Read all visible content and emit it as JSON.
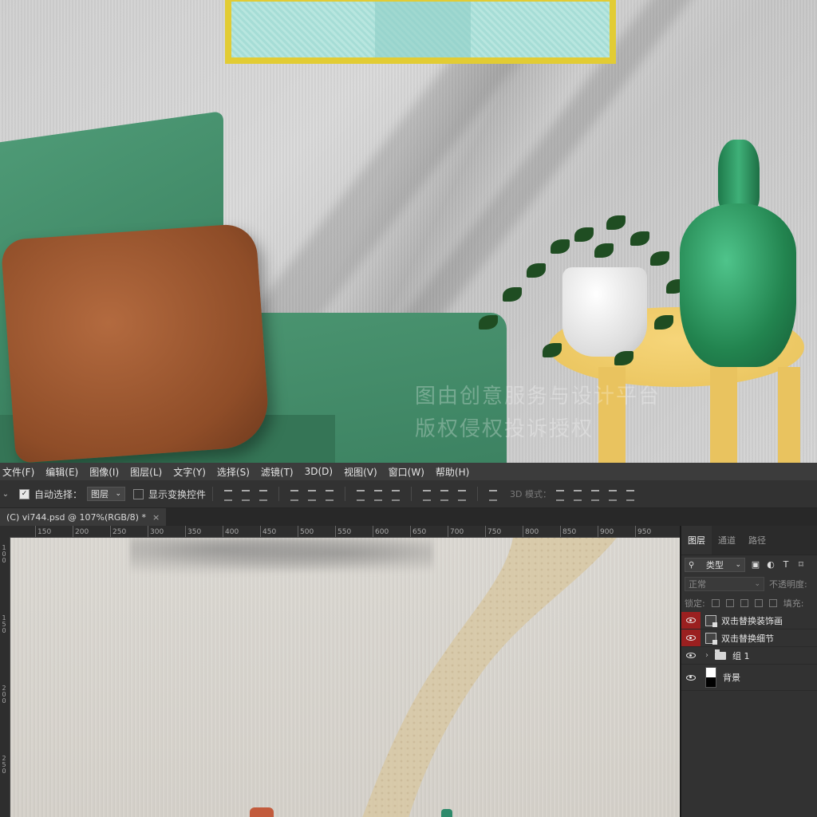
{
  "scene": {
    "watermark_line1": "图由创意服务与设计平台",
    "watermark_line2": "版权侵权投诉授权"
  },
  "menubar": {
    "items": [
      "文件(F)",
      "编辑(E)",
      "图像(I)",
      "图层(L)",
      "文字(Y)",
      "选择(S)",
      "滤镜(T)",
      "3D(D)",
      "视图(V)",
      "窗口(W)",
      "帮助(H)"
    ]
  },
  "options": {
    "auto_select_label": "自动选择：",
    "auto_select_value": "图层",
    "show_transform_label": "显示变换控件",
    "mode_3d_label": "3D 模式："
  },
  "tab": {
    "title": "(C) vi744.psd @ 107%(RGB/8) *",
    "close": "×"
  },
  "ruler": {
    "top_ticks": [
      "150",
      "200",
      "250",
      "300",
      "350",
      "400",
      "450",
      "500",
      "550",
      "600",
      "650",
      "700",
      "750",
      "800",
      "850",
      "900",
      "950"
    ],
    "left_ticks": [
      "100",
      "150",
      "200",
      "250"
    ]
  },
  "layers_panel": {
    "tabs": [
      "图层",
      "通道",
      "路径"
    ],
    "kind_label": "类型",
    "blend_mode": "正常",
    "opacity_label": "不透明度:",
    "lock_label": "锁定:",
    "fill_label": "填充:",
    "layers": [
      {
        "name": "双击替换装饰画",
        "eye_highlight": true,
        "type": "smart"
      },
      {
        "name": "双击替换细节",
        "eye_highlight": true,
        "type": "smart"
      },
      {
        "name": "组 1",
        "eye_highlight": false,
        "type": "group"
      },
      {
        "name": "背景",
        "eye_highlight": false,
        "type": "background"
      }
    ]
  },
  "colors": {
    "menubar_bg": "#3c3c3c",
    "panel_bg": "#323232",
    "eye_highlight": "#9b2020",
    "sofa_green": "#3d8563",
    "pillow_brown": "#8f4d28",
    "table_yellow": "#e8c25a",
    "frame_yellow": "#e2cc34"
  }
}
